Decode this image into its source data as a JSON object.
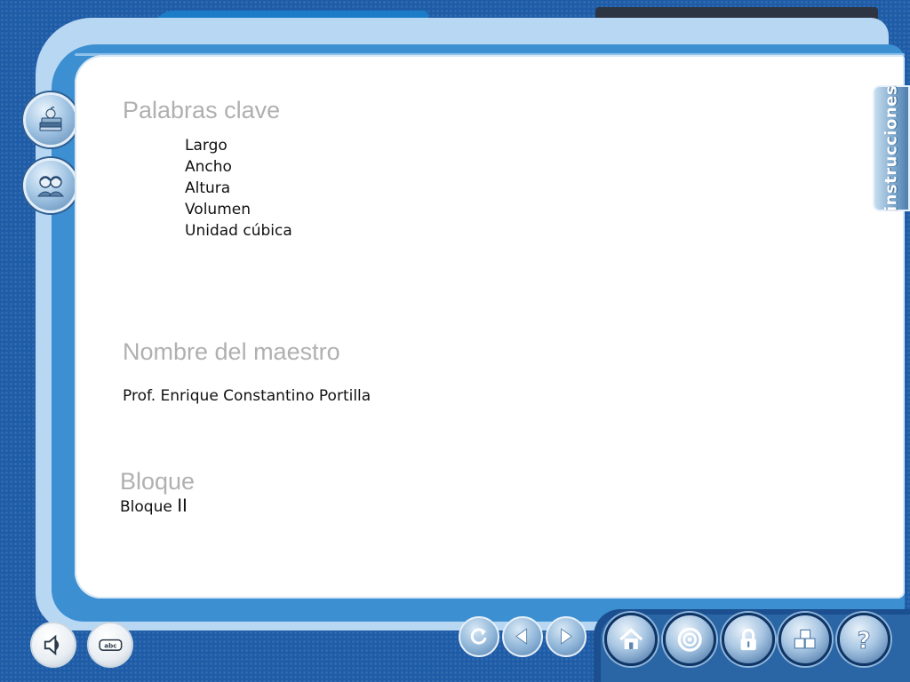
{
  "sidebar": {
    "items": [
      {
        "icon": "books-apple-icon"
      },
      {
        "icon": "students-icon"
      }
    ]
  },
  "instructions_tab": {
    "label": "instrucciones"
  },
  "content": {
    "keywords_heading": "Palabras clave",
    "keywords": [
      "Largo",
      "Ancho",
      "Altura",
      "Volumen",
      "Unidad cúbica"
    ],
    "teacher_heading": "Nombre del maestro",
    "teacher_name": "Prof. Enrique Constantino Portilla",
    "block_heading": "Bloque",
    "block_label": "Bloque",
    "block_number": "II"
  },
  "bottom_left": {
    "audio_icon": "speaker-icon",
    "glossary_label": "abc"
  },
  "navigation": {
    "icons": [
      "refresh-icon",
      "back-arrow-icon",
      "forward-arrow-icon"
    ]
  },
  "toolbar": {
    "icons": [
      "home-icon",
      "target-icon",
      "lock-icon",
      "blocks-icon",
      "help-icon"
    ],
    "help_label": "?"
  },
  "colors": {
    "background": "#1f5ca7",
    "frame": "#3c8fd1",
    "heading_text": "#b0b0b0",
    "body_text": "#111111"
  }
}
